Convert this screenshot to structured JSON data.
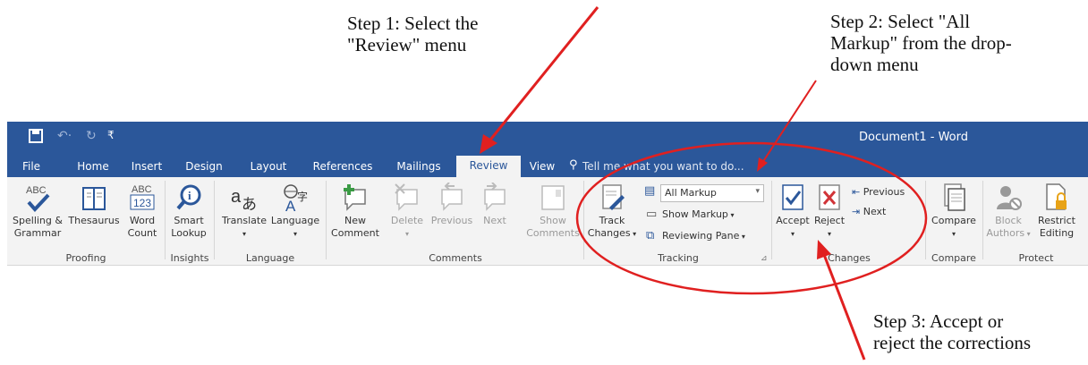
{
  "annotations": {
    "step1": "Step 1: Select the\n\"Review\" menu",
    "step2": "Step 2: Select \"All\nMarkup\" from the drop-\ndown menu",
    "step3": "Step 3: Accept or\nreject the corrections"
  },
  "window": {
    "title": "Document1 - Word"
  },
  "tabs": [
    "File",
    "Home",
    "Insert",
    "Design",
    "Layout",
    "References",
    "Mailings",
    "Review",
    "View"
  ],
  "tell_me": "Tell me what you want to do...",
  "ribbon": {
    "proofing": {
      "label": "Proofing",
      "spelling": "Spelling &\nGrammar",
      "thesaurus": "Thesaurus",
      "word_count": "Word\nCount"
    },
    "insights": {
      "label": "Insights",
      "smart_lookup": "Smart\nLookup"
    },
    "language": {
      "label": "Language",
      "translate": "Translate",
      "language": "Language"
    },
    "comments": {
      "label": "Comments",
      "new": "New\nComment",
      "delete": "Delete",
      "previous": "Previous",
      "next": "Next",
      "show": "Show\nComments"
    },
    "tracking": {
      "label": "Tracking",
      "track": "Track\nChanges",
      "markup_select": "All Markup",
      "show_markup": "Show Markup",
      "reviewing_pane": "Reviewing Pane"
    },
    "changes": {
      "label": "Changes",
      "accept": "Accept",
      "reject": "Reject",
      "previous": "Previous",
      "next": "Next"
    },
    "compare": {
      "label": "Compare",
      "compare": "Compare"
    },
    "protect": {
      "label": "Protect",
      "block": "Block\nAuthors",
      "restrict": "Restrict\nEditing"
    }
  },
  "colors": {
    "brand": "#2b579a",
    "annotation": "#e02020"
  },
  "icons": [
    "save-icon",
    "undo-icon",
    "redo-icon",
    "customize-qat-icon",
    "abc-check-icon",
    "thesaurus-book-icon",
    "word-count-icon",
    "smart-lookup-icon",
    "translate-icon",
    "language-icon",
    "new-comment-icon",
    "delete-comment-icon",
    "previous-comment-icon",
    "next-comment-icon",
    "show-comments-icon",
    "track-changes-icon",
    "markup-icon",
    "show-markup-icon",
    "reviewing-pane-icon",
    "accept-icon",
    "reject-icon",
    "previous-change-icon",
    "next-change-icon",
    "compare-icon",
    "block-authors-icon",
    "restrict-editing-icon",
    "lightbulb-icon",
    "dialog-launcher-icon"
  ]
}
